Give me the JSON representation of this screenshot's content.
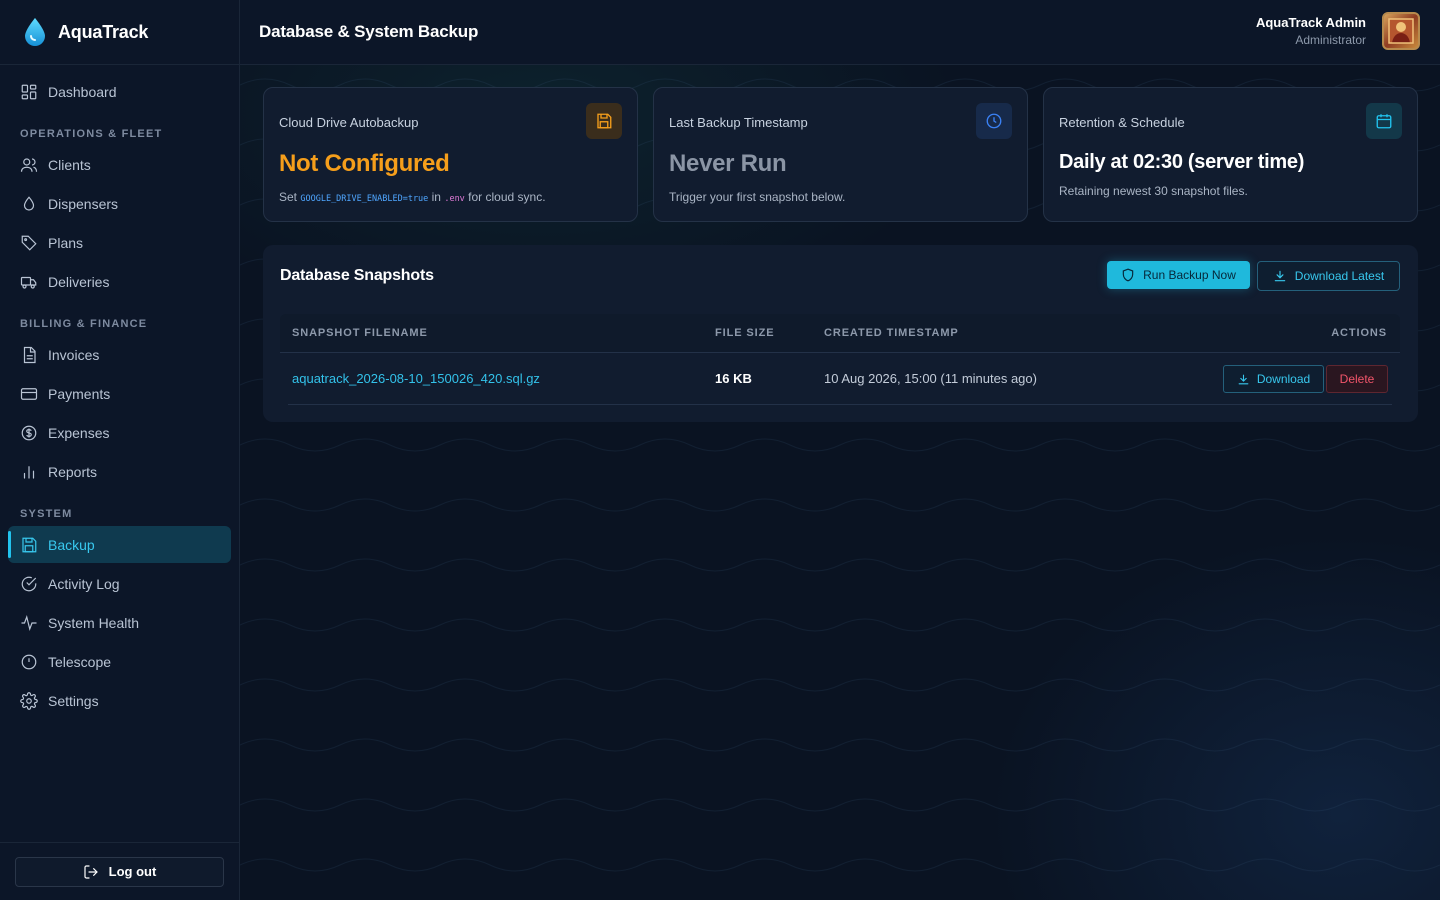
{
  "app": {
    "name": "AquaTrack"
  },
  "sidebar": {
    "dashboard": "Dashboard",
    "sections": {
      "operations": "OPERATIONS & FLEET",
      "billing": "BILLING & FINANCE",
      "system": "SYSTEM"
    },
    "items": {
      "clients": "Clients",
      "dispensers": "Dispensers",
      "plans": "Plans",
      "deliveries": "Deliveries",
      "invoices": "Invoices",
      "payments": "Payments",
      "expenses": "Expenses",
      "reports": "Reports",
      "backup": "Backup",
      "activity_log": "Activity Log",
      "system_health": "System Health",
      "telescope": "Telescope",
      "settings": "Settings"
    },
    "active": "Backup",
    "logout": "Log out"
  },
  "header": {
    "title": "Database & System Backup",
    "user_name": "AquaTrack Admin",
    "user_role": "Administrator"
  },
  "cards": {
    "cloud": {
      "label": "Cloud Drive Autobackup",
      "value": "Not Configured",
      "sub_prefix": "Set",
      "sub_code": "GOOGLE_DRIVE_ENABLED=true",
      "sub_mid": "in",
      "sub_env": ".env",
      "sub_suffix": "for cloud sync.",
      "icon": "save-icon",
      "color": "#f59e1b"
    },
    "last": {
      "label": "Last Backup Timestamp",
      "value": "Never Run",
      "sub": "Trigger your first snapshot below.",
      "icon": "clock-icon",
      "color": "#8b95a5"
    },
    "retention": {
      "label": "Retention & Schedule",
      "value": "Daily at 02:30 (server time)",
      "sub": "Retaining newest 30 snapshot files.",
      "icon": "calendar-icon",
      "color": "#ffffff"
    }
  },
  "snapshots": {
    "title": "Database Snapshots",
    "run_label": "Run Backup Now",
    "download_latest_label": "Download Latest",
    "columns": [
      "SNAPSHOT FILENAME",
      "FILE SIZE",
      "CREATED TIMESTAMP",
      "ACTIONS"
    ],
    "rows": [
      {
        "filename": "aquatrack_2026-08-10_150026_420.sql.gz",
        "size": "16 KB",
        "created": "10 Aug 2026, 15:00 (11 minutes ago)",
        "download": "Download",
        "delete": "Delete"
      }
    ]
  },
  "colors": {
    "accent": "#22c3ee",
    "warning": "#f59e1b",
    "danger": "#f2556a"
  }
}
